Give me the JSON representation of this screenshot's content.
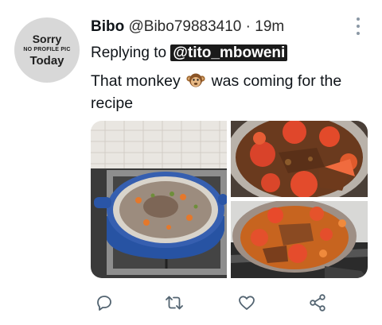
{
  "tweet": {
    "avatar": {
      "line1": "Sorry",
      "line2": "NO PROFILE PIC",
      "line3": "Today"
    },
    "author_name": "Bibo",
    "author_handle": "@Bibo79883410",
    "separator": "·",
    "time": "19m",
    "replying_prefix": "Replying to",
    "replying_to": "@tito_mboweni",
    "text_before_emoji": "That monkey",
    "emoji": "monkey-icon",
    "text_after_emoji": "was coming for the recipe"
  },
  "media": [
    {
      "name": "pot-on-stove-photo"
    },
    {
      "name": "tomatoes-and-meat-photo"
    },
    {
      "name": "stew-in-pot-photo"
    }
  ],
  "actions": [
    {
      "icon": "reply-icon"
    },
    {
      "icon": "retweet-icon"
    },
    {
      "icon": "like-icon"
    },
    {
      "icon": "share-icon"
    }
  ],
  "colors": {
    "icon_gray": "#536471",
    "text": "#0f1419",
    "avatar_bg": "#d8d8d8"
  }
}
